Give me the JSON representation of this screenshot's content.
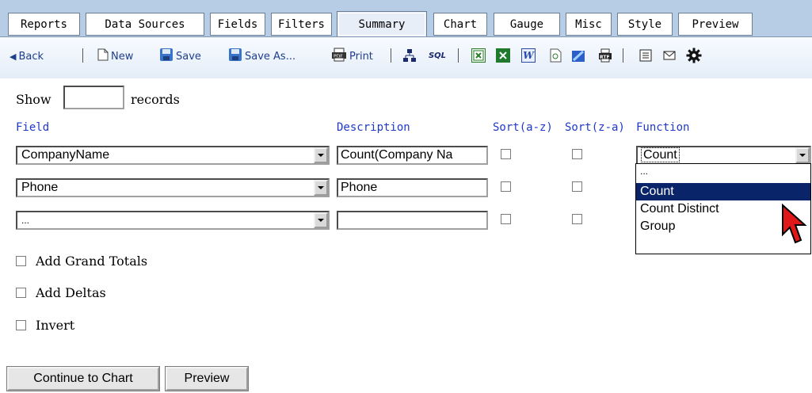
{
  "tabs": [
    {
      "label": "Reports"
    },
    {
      "label": "Data Sources"
    },
    {
      "label": "Fields"
    },
    {
      "label": "Filters"
    },
    {
      "label": "Summary",
      "active": true
    },
    {
      "label": "Chart"
    },
    {
      "label": "Gauge"
    },
    {
      "label": "Misc"
    },
    {
      "label": "Style"
    },
    {
      "label": "Preview"
    }
  ],
  "toolbar": {
    "back": "Back",
    "new": "New",
    "save": "Save",
    "save_as": "Save As...",
    "print": "Print",
    "sql": "SQL",
    "icons": [
      "back-arrow-icon",
      "new-document-icon",
      "save-icon",
      "save-as-icon",
      "print-icon",
      "sitemap-icon",
      "sql-icon",
      "excel-export-icon",
      "excel-icon",
      "word-icon",
      "html-export-icon",
      "pdf-icon",
      "rtf-icon",
      "list-icon",
      "email-icon",
      "gear-icon"
    ],
    "rtf": "RTF",
    "pdf": "PDF"
  },
  "show": {
    "prefix": "Show",
    "value": "",
    "suffix": "records"
  },
  "columns": {
    "field": "Field",
    "description": "Description",
    "sort_az": "Sort(a-z)",
    "sort_za": "Sort(z-a)",
    "function": "Function"
  },
  "rows": [
    {
      "field": "CompanyName",
      "description": "Count(Company Na",
      "sort_az": false,
      "sort_za": false
    },
    {
      "field": "Phone",
      "description": "Phone",
      "sort_az": false,
      "sort_za": false
    },
    {
      "field": "...",
      "description": "",
      "sort_az": false,
      "sort_za": false
    }
  ],
  "function_select": {
    "value": "Count",
    "options": [
      "...",
      "Count",
      "Count Distinct",
      "Group"
    ],
    "highlighted": "Count"
  },
  "options": {
    "grand_totals": "Add Grand Totals",
    "deltas": "Add Deltas",
    "invert": "Invert"
  },
  "buttons": {
    "continue": "Continue to Chart",
    "preview": "Preview"
  },
  "colors": {
    "tabbar_bg": "#b7cde6",
    "label_blue": "#1f39c9",
    "highlight": "#0a246a"
  }
}
